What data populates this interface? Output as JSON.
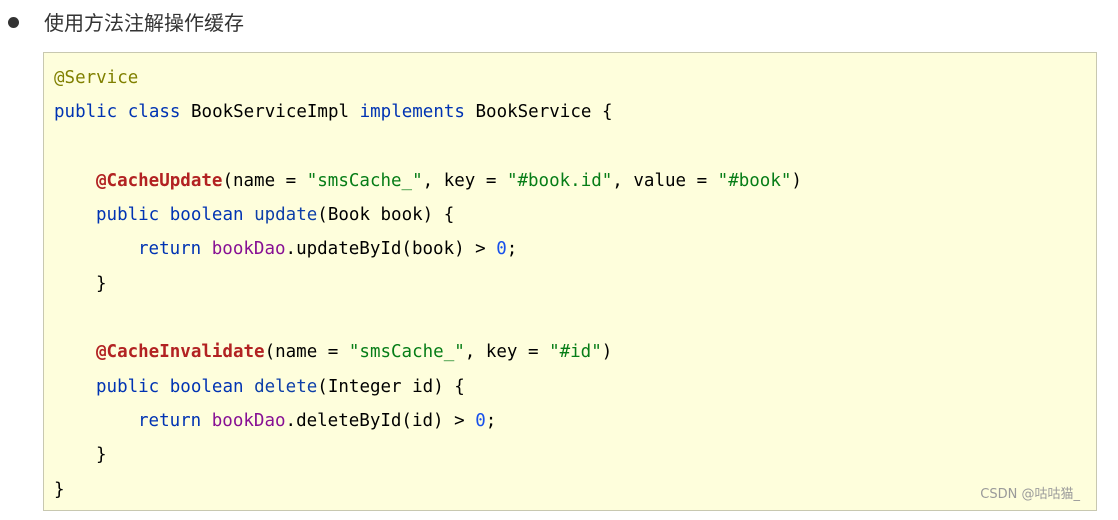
{
  "bullet": {
    "text": "使用方法注解操作缓存"
  },
  "code": {
    "line1": {
      "annotation": "@Service"
    },
    "line2": {
      "kw_public": "public",
      "kw_class": "class",
      "class_name": "BookServiceImpl",
      "kw_implements": "implements",
      "interface_name": "BookService",
      "brace": "{"
    },
    "line4": {
      "annotation": "@CacheUpdate",
      "args_open": "(name = ",
      "str_name": "\"smsCache_\"",
      "args_key": ", key = ",
      "str_key": "\"#book.id\"",
      "args_value": ", value = ",
      "str_value": "\"#book\"",
      "args_close": ")"
    },
    "line5": {
      "kw_public": "public",
      "kw_boolean": "boolean",
      "method": "update",
      "params": "(Book book) {"
    },
    "line6": {
      "kw_return": "return",
      "field": "bookDao",
      "call": ".updateById(book) > ",
      "number": "0",
      "semicolon": ";"
    },
    "line7": {
      "brace": "}"
    },
    "line9": {
      "annotation": "@CacheInvalidate",
      "args_open": "(name = ",
      "str_name": "\"smsCache_\"",
      "args_key": ", key = ",
      "str_key": "\"#id\"",
      "args_close": ")"
    },
    "line10": {
      "kw_public": "public",
      "kw_boolean": "boolean",
      "method": "delete",
      "params": "(Integer id) {"
    },
    "line11": {
      "kw_return": "return",
      "field": "bookDao",
      "call": ".deleteById(id) > ",
      "number": "0",
      "semicolon": ";"
    },
    "line12": {
      "brace": "}"
    },
    "line13": {
      "brace": "}"
    }
  },
  "watermark": "CSDN @咕咕猫_",
  "colors": {
    "code_background": "#fefedc",
    "annotation": "#808000",
    "keyword": "#0033b3",
    "annotation_bold": "#b22222",
    "string": "#067d17",
    "field": "#871094",
    "number": "#1750eb"
  }
}
